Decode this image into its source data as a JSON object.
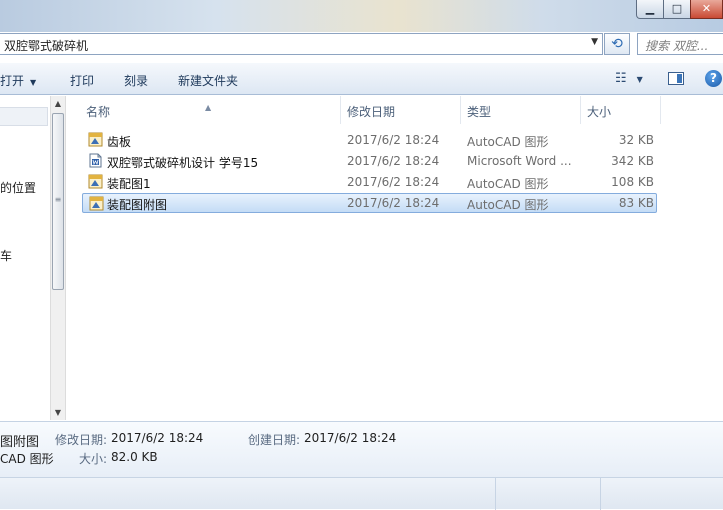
{
  "window": {
    "minimize_glyph": "▁",
    "maximize_glyph": "□",
    "close_glyph": "✕"
  },
  "address": {
    "path": "双腔鄂式破碎机",
    "dropdown_icon": "chevron-down-icon",
    "refresh_icon": "refresh-icon",
    "refresh_glyph": "⟲"
  },
  "search": {
    "placeholder": "搜索 双腔..."
  },
  "toolbar": {
    "open_label": "打开",
    "print_label": "打印",
    "burn_label": "刻录",
    "new_folder_label": "新建文件夹",
    "view_glyph": "☷",
    "help_glyph": "?"
  },
  "nav": {
    "fragments": [
      {
        "text": "的位置"
      },
      {
        "text": "车"
      }
    ]
  },
  "columns": {
    "name": "名称",
    "date": "修改日期",
    "type": "类型",
    "size": "大小"
  },
  "files": [
    {
      "name": "齿板",
      "date": "2017/6/2 18:24",
      "type": "AutoCAD 图形",
      "size": "32 KB",
      "icon": "autocad-file-icon"
    },
    {
      "name": "双腔鄂式破碎机设计 学号15",
      "date": "2017/6/2 18:24",
      "type": "Microsoft Word ...",
      "size": "342 KB",
      "icon": "word-file-icon"
    },
    {
      "name": "装配图1",
      "date": "2017/6/2 18:24",
      "type": "AutoCAD 图形",
      "size": "108 KB",
      "icon": "autocad-file-icon"
    },
    {
      "name": "装配图附图",
      "date": "2017/6/2 18:24",
      "type": "AutoCAD 图形",
      "size": "83 KB",
      "icon": "autocad-file-icon",
      "selected": true
    }
  ],
  "details": {
    "name_fragment": "图附图",
    "type_fragment": "CAD 图形",
    "modified_label": "修改日期:",
    "modified_value": "2017/6/2 18:24",
    "created_label": "创建日期:",
    "created_value": "2017/6/2 18:24",
    "size_label": "大小:",
    "size_value": "82.0 KB"
  },
  "colors": {
    "selection": "#c4dcf6",
    "accent": "#1e395b"
  }
}
